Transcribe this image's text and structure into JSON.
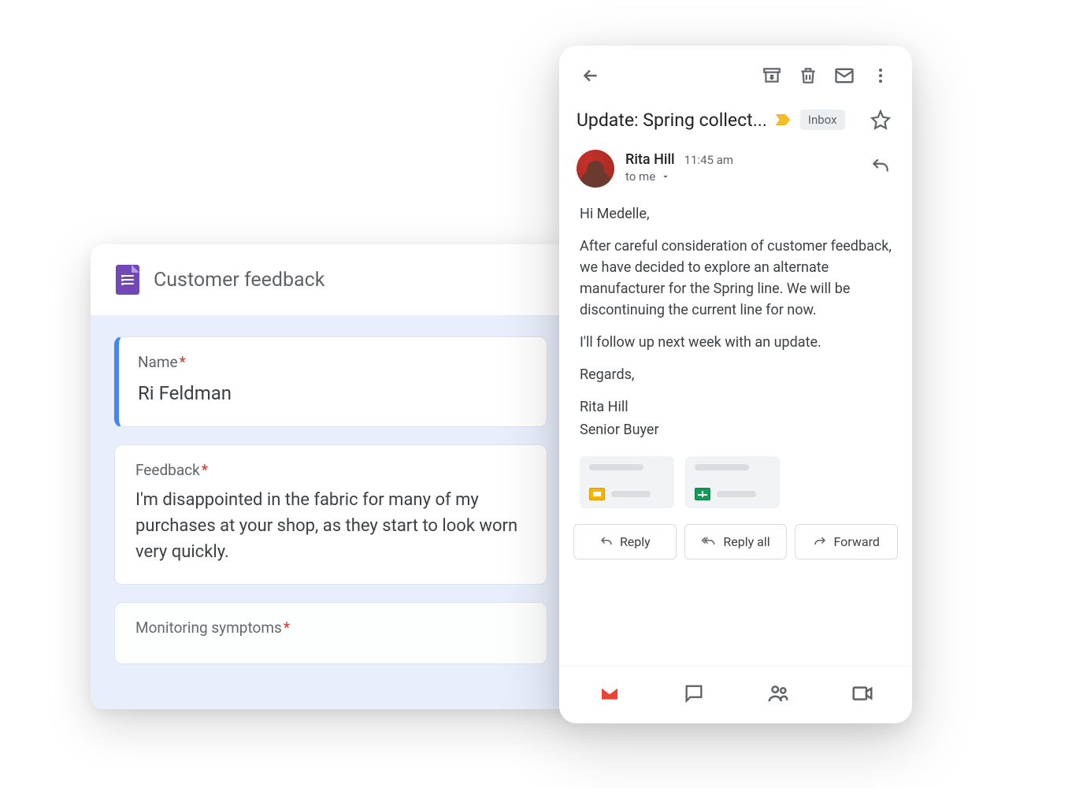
{
  "forms": {
    "title": "Customer feedback",
    "fields": [
      {
        "label": "Name",
        "required": true,
        "value": "Ri Feldman",
        "active": true
      },
      {
        "label": "Feedback",
        "required": true,
        "value": "I'm disappointed in the fabric for many of my purchases at your shop, as they start to look worn very quickly.",
        "active": false
      },
      {
        "label": "Monitoring symptoms",
        "required": true,
        "value": "",
        "active": false
      }
    ]
  },
  "gmail": {
    "subject": "Update: Spring collect...",
    "inbox_chip": "Inbox",
    "sender": {
      "name": "Rita Hill",
      "time": "11:45 am",
      "to": "to me"
    },
    "body": {
      "greeting": "Hi Medelle,",
      "p1": "After careful consideration of customer feedback, we have decided to explore an alternate manufacturer for the Spring line. We will be discontinuing the current line for now.",
      "p2": "I'll follow up next week with an update.",
      "closing": "Regards,",
      "sig1": "Rita Hill",
      "sig2": "Senior Buyer"
    },
    "actions": {
      "reply": "Reply",
      "reply_all": "Reply all",
      "forward": "Forward"
    }
  }
}
